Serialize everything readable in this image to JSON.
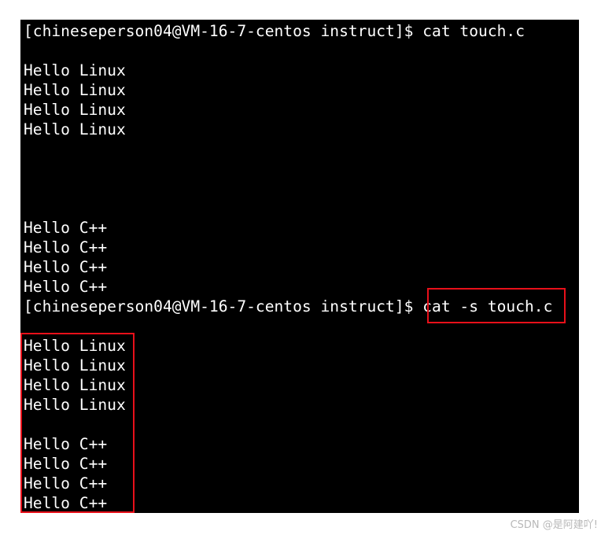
{
  "terminal": {
    "lines": [
      "[chineseperson04@VM-16-7-centos instruct]$ cat touch.c",
      "",
      "Hello Linux",
      "Hello Linux",
      "Hello Linux",
      "Hello Linux",
      "",
      "",
      "",
      "",
      "Hello C++",
      "Hello C++",
      "Hello C++",
      "Hello C++",
      "[chineseperson04@VM-16-7-centos instruct]$ cat -s touch.c",
      "",
      "Hello Linux",
      "Hello Linux",
      "Hello Linux",
      "Hello Linux",
      "",
      "Hello C++",
      "Hello C++",
      "Hello C++",
      "Hello C++"
    ],
    "background": "#000000",
    "foreground": "#ffffff",
    "highlight_color": "#e8101a"
  },
  "watermark": "CSDN @是阿建吖!"
}
